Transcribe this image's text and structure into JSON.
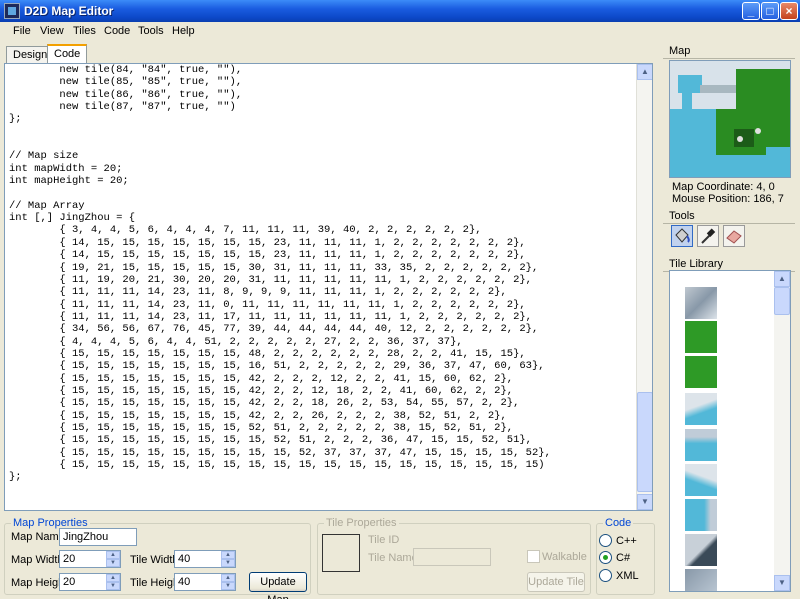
{
  "window": {
    "title": "D2D Map Editor"
  },
  "menu": [
    "File",
    "View",
    "Tiles",
    "Code",
    "Tools",
    "Help"
  ],
  "tabs": [
    {
      "label": "Designer",
      "active": false
    },
    {
      "label": "Code",
      "active": true
    }
  ],
  "code_lines": [
    "        new tile(84, \"84\", true, \"\"),",
    "        new tile(85, \"85\", true, \"\"),",
    "        new tile(86, \"86\", true, \"\"),",
    "        new tile(87, \"87\", true, \"\")",
    "};",
    "",
    "",
    "// Map size",
    "int mapWidth = 20;",
    "int mapHeight = 20;",
    "",
    "// Map Array",
    "int [,] JingZhou = {",
    "        { 3, 4, 4, 5, 6, 4, 4, 4, 7, 11, 11, 11, 39, 40, 2, 2, 2, 2, 2, 2},",
    "        { 14, 15, 15, 15, 15, 15, 15, 15, 23, 11, 11, 11, 1, 2, 2, 2, 2, 2, 2, 2},",
    "        { 14, 15, 15, 15, 15, 15, 15, 15, 23, 11, 11, 11, 1, 2, 2, 2, 2, 2, 2, 2},",
    "        { 19, 21, 15, 15, 15, 15, 15, 30, 31, 11, 11, 11, 33, 35, 2, 2, 2, 2, 2, 2},",
    "        { 11, 19, 20, 21, 30, 20, 20, 31, 11, 11, 11, 11, 11, 1, 2, 2, 2, 2, 2, 2},",
    "        { 11, 11, 11, 14, 23, 11, 8, 9, 9, 9, 11, 11, 11, 1, 2, 2, 2, 2, 2, 2},",
    "        { 11, 11, 11, 14, 23, 11, 0, 11, 11, 11, 11, 11, 11, 1, 2, 2, 2, 2, 2, 2},",
    "        { 11, 11, 11, 14, 23, 11, 17, 11, 11, 11, 11, 11, 11, 1, 2, 2, 2, 2, 2, 2},",
    "        { 34, 56, 56, 67, 76, 45, 77, 39, 44, 44, 44, 44, 40, 12, 2, 2, 2, 2, 2, 2},",
    "        { 4, 4, 4, 5, 6, 4, 4, 51, 2, 2, 2, 2, 2, 27, 2, 2, 36, 37, 37},",
    "        { 15, 15, 15, 15, 15, 15, 15, 48, 2, 2, 2, 2, 2, 2, 28, 2, 2, 41, 15, 15},",
    "        { 15, 15, 15, 15, 15, 15, 15, 16, 51, 2, 2, 2, 2, 2, 29, 36, 37, 47, 60, 63},",
    "        { 15, 15, 15, 15, 15, 15, 15, 42, 2, 2, 2, 12, 2, 2, 41, 15, 60, 62, 2},",
    "        { 15, 15, 15, 15, 15, 15, 15, 42, 2, 2, 12, 18, 2, 2, 41, 60, 62, 2, 2},",
    "        { 15, 15, 15, 15, 15, 15, 15, 42, 2, 2, 18, 26, 2, 53, 54, 55, 57, 2, 2},",
    "        { 15, 15, 15, 15, 15, 15, 15, 42, 2, 2, 26, 2, 2, 2, 38, 52, 51, 2, 2},",
    "        { 15, 15, 15, 15, 15, 15, 15, 52, 51, 2, 2, 2, 2, 2, 38, 15, 52, 51, 2},",
    "        { 15, 15, 15, 15, 15, 15, 15, 15, 52, 51, 2, 2, 2, 36, 47, 15, 15, 52, 51},",
    "        { 15, 15, 15, 15, 15, 15, 15, 15, 15, 52, 37, 37, 37, 47, 15, 15, 15, 15, 52},",
    "        { 15, 15, 15, 15, 15, 15, 15, 15, 15, 15, 15, 15, 15, 15, 15, 15, 15, 15, 15)",
    "};"
  ],
  "map_properties": {
    "title": "Map Properties",
    "name_label": "Map Name",
    "name_value": "JingZhou",
    "width_label": "Map Width",
    "width_value": "20",
    "height_label": "Map Height",
    "height_value": "20",
    "tile_width_label": "Tile Width",
    "tile_width_value": "40",
    "tile_height_label": "Tile Height",
    "tile_height_value": "40",
    "update_button": "Update Map"
  },
  "tile_properties": {
    "title": "Tile Properties",
    "id_label": "Tile ID",
    "name_label": "Tile Name",
    "walkable_label": "Walkable",
    "update_button": "Update Tile"
  },
  "code_options": {
    "title": "Code",
    "options": [
      "C++",
      "C#",
      "XML"
    ],
    "selected": "C#"
  },
  "map_panel": {
    "title": "Map",
    "coordinate": "Map Coordinate: 4, 0",
    "mouse_position": "Mouse Position: 186, 7"
  },
  "tools_panel": {
    "title": "Tools",
    "tools": [
      "paint-bucket-icon",
      "eyedropper-icon",
      "eraser-icon"
    ],
    "selected": "paint-bucket-icon"
  },
  "tile_library": {
    "title": "Tile Library"
  }
}
